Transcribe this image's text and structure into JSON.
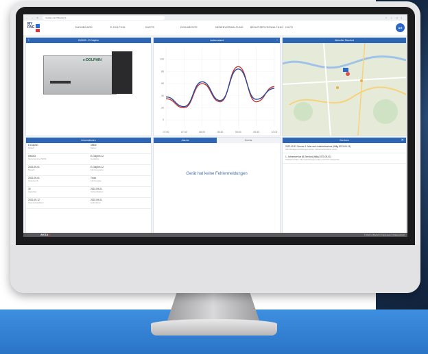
{
  "browser": {
    "url": "myofac.com/?device=1",
    "nav": "← → C",
    "tools": "☆ ⋮ ▢ ⤓"
  },
  "app": {
    "logo_line1": "MY",
    "logo_line2": "PAC",
    "menu": [
      "DASHBOARD",
      "E-DOLPHIN",
      "KARTE",
      "DOKUMENTE",
      "NEBENVERWALTUNG",
      "BENUTZERVERWALTUNG",
      "HILFE"
    ],
    "avatar": "AG"
  },
  "panels": {
    "device": {
      "title": "000003 - E-Dolphin",
      "product_label": "e-DOLPHIN"
    },
    "chart": {
      "title": "Ladezustand"
    },
    "location": {
      "title": "Aktueller Standort"
    },
    "info": {
      "title": "Informationen",
      "rows": [
        [
          {
            "v": "E-Dolphin",
            "k": "Modell"
          },
          {
            "v": "offline",
            "k": "Status"
          }
        ],
        [
          {
            "v": "000003",
            "k": "Seriennummer MIOS"
          },
          {
            "v": "E-Dolphin 12",
            "k": "Gerätetyp"
          }
        ],
        [
          {
            "v": "2022-09-01",
            "k": "Baujahr"
          },
          {
            "v": "E-Dolphin 12",
            "k": "Fahrzeugname"
          }
        ],
        [
          {
            "v": "2022-09-01",
            "k": "Garantie bis"
          },
          {
            "v": "Truck",
            "k": "Fahrzeugtyp"
          }
        ],
        [
          {
            "v": "30",
            "k": "Kapazität"
          },
          {
            "v": "2022-09-01",
            "k": "Verkaufsdatum"
          }
        ],
        [
          {
            "v": "2022-09-12",
            "k": "Zuweisungsdatum"
          },
          {
            "v": "2022-09-01",
            "k": "Lieferdatum"
          }
        ]
      ]
    },
    "alarms": {
      "tab_alarme": "Alarme",
      "tab_events": "Events",
      "message": "Gerät hat keine Fehlermeldungen"
    },
    "services": {
      "title": "Services",
      "items": [
        {
          "a": "2022-09-13 Service 1 Jahr nach Inbetriebnahme (fällig 2023-09-13)",
          "b": "Alle Montagevorrichtungen prüfen, Sicherheitsfunktion prüfen"
        },
        {
          "a": "1. Jahresservice (B-Service) (fällig 2023-09-01)",
          "b": "Softwareupdate, Alle Verbindungen prüfen, Services überprüfen"
        }
      ]
    }
  },
  "footer": {
    "brand_a": "AKSA",
    "brand_b": " ■",
    "copy": "© 2022 inPacGO | Impressum | Datenschutz"
  },
  "chart_data": {
    "type": "line",
    "title": "Ladezustand",
    "x": [
      "07:00",
      "07:30",
      "08:00",
      "08:30",
      "09:00",
      "09:30",
      "10:00"
    ],
    "yticks": [
      0,
      20,
      40,
      60,
      80,
      100
    ],
    "ylim": [
      -10,
      120
    ],
    "series": [
      {
        "color": "#c03a3a",
        "values": [
          35,
          20,
          60,
          30,
          88,
          30,
          55
        ]
      },
      {
        "color": "#2b4a9a",
        "values": [
          38,
          22,
          63,
          32,
          84,
          34,
          52
        ]
      }
    ]
  }
}
